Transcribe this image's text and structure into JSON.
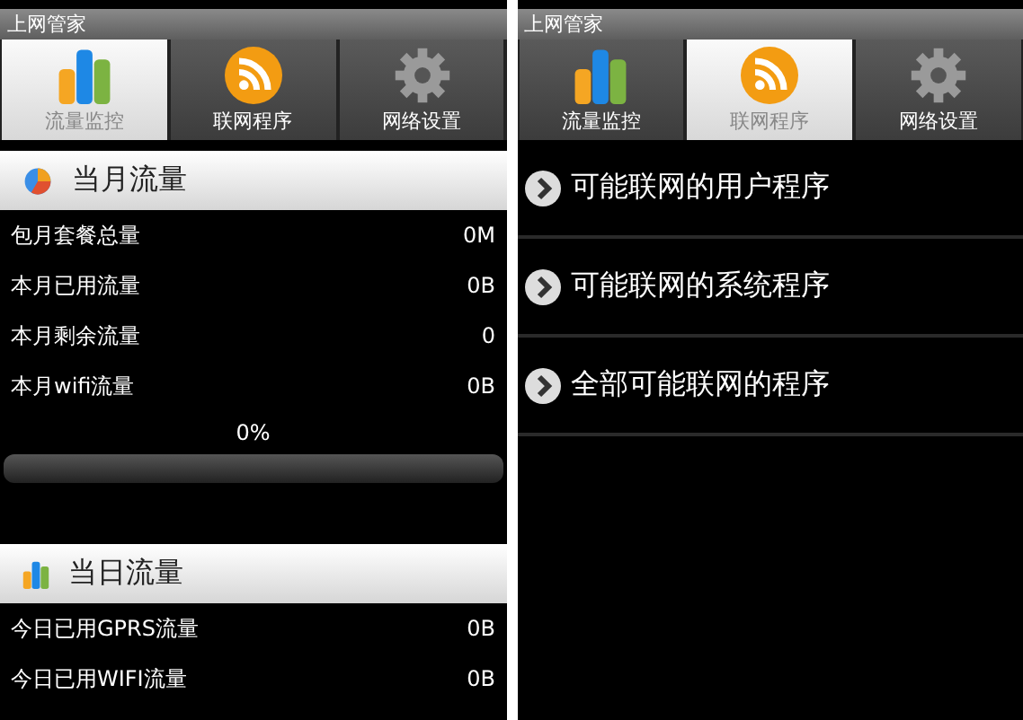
{
  "screens": [
    {
      "title": "上网管家",
      "tabs": [
        {
          "label": "流量监控",
          "selected": true
        },
        {
          "label": "联网程序",
          "selected": false
        },
        {
          "label": "网络设置",
          "selected": false
        }
      ],
      "content": {
        "kind": "traffic",
        "sections": [
          {
            "title": "当月流量",
            "rows": [
              {
                "label": "包月套餐总量",
                "value": "0M"
              },
              {
                "label": "本月已用流量",
                "value": "0B"
              },
              {
                "label": "本月剩余流量",
                "value": "0"
              },
              {
                "label": "本月wifi流量",
                "value": "0B"
              }
            ],
            "progress": {
              "reading": "0%",
              "level": 0
            }
          },
          {
            "title": "当日流量",
            "rows": [
              {
                "label": "今日已用GPRS流量",
                "value": "0B"
              },
              {
                "label": "今日已用WIFI流量",
                "value": "0B"
              }
            ]
          }
        ]
      }
    },
    {
      "title": "上网管家",
      "tabs": [
        {
          "label": "流量监控",
          "selected": false
        },
        {
          "label": "联网程序",
          "selected": true
        },
        {
          "label": "网络设置",
          "selected": false
        }
      ],
      "content": {
        "kind": "menu",
        "items": [
          "可能联网的用户程序",
          "可能联网的系统程序",
          "全部可能联网的程序"
        ]
      }
    }
  ]
}
